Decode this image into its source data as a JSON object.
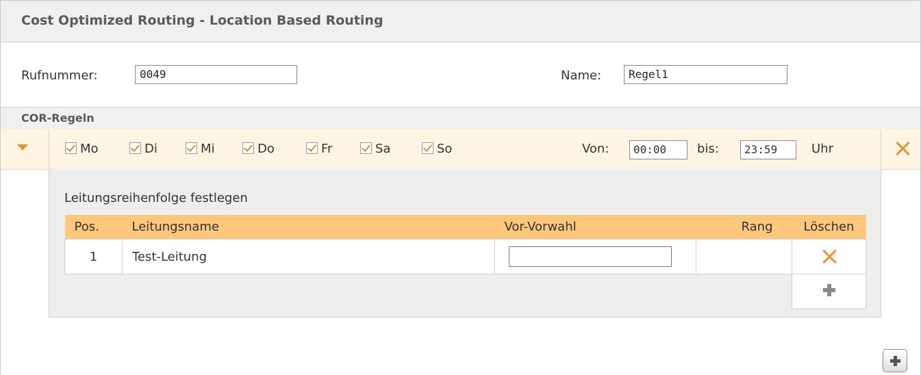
{
  "title": "Cost Optimized Routing - Location Based Routing",
  "rufnummer": {
    "label": "Rufnummer:",
    "value": "0049"
  },
  "name": {
    "label": "Name:",
    "value": "Regel1"
  },
  "section_title": "COR-Regeln",
  "rule": {
    "days": [
      {
        "label": "Mo",
        "checked": true
      },
      {
        "label": "Di",
        "checked": true
      },
      {
        "label": "Mi",
        "checked": true
      },
      {
        "label": "Do",
        "checked": true
      },
      {
        "label": "Fr",
        "checked": true
      },
      {
        "label": "Sa",
        "checked": true
      },
      {
        "label": "So",
        "checked": true
      }
    ],
    "from_label": "Von:",
    "from_value": "00:00",
    "to_label": "bis:",
    "to_value": "23:59",
    "unit": "Uhr"
  },
  "lines": {
    "heading": "Leitungsreihenfolge festlegen",
    "columns": [
      "Pos.",
      "Leitungsname",
      "Vor-Vorwahl",
      "Rang",
      "Löschen"
    ],
    "rows": [
      {
        "pos": "1",
        "name": "Test-Leitung",
        "prefix": "",
        "rank": ""
      }
    ]
  },
  "icons": {
    "expand": "caret-down-icon",
    "delete": "close-icon",
    "add": "plus-icon"
  },
  "colors": {
    "accent": "#e8922a",
    "table_header": "#fdc77c",
    "rule_bg": "#fef4e4"
  }
}
